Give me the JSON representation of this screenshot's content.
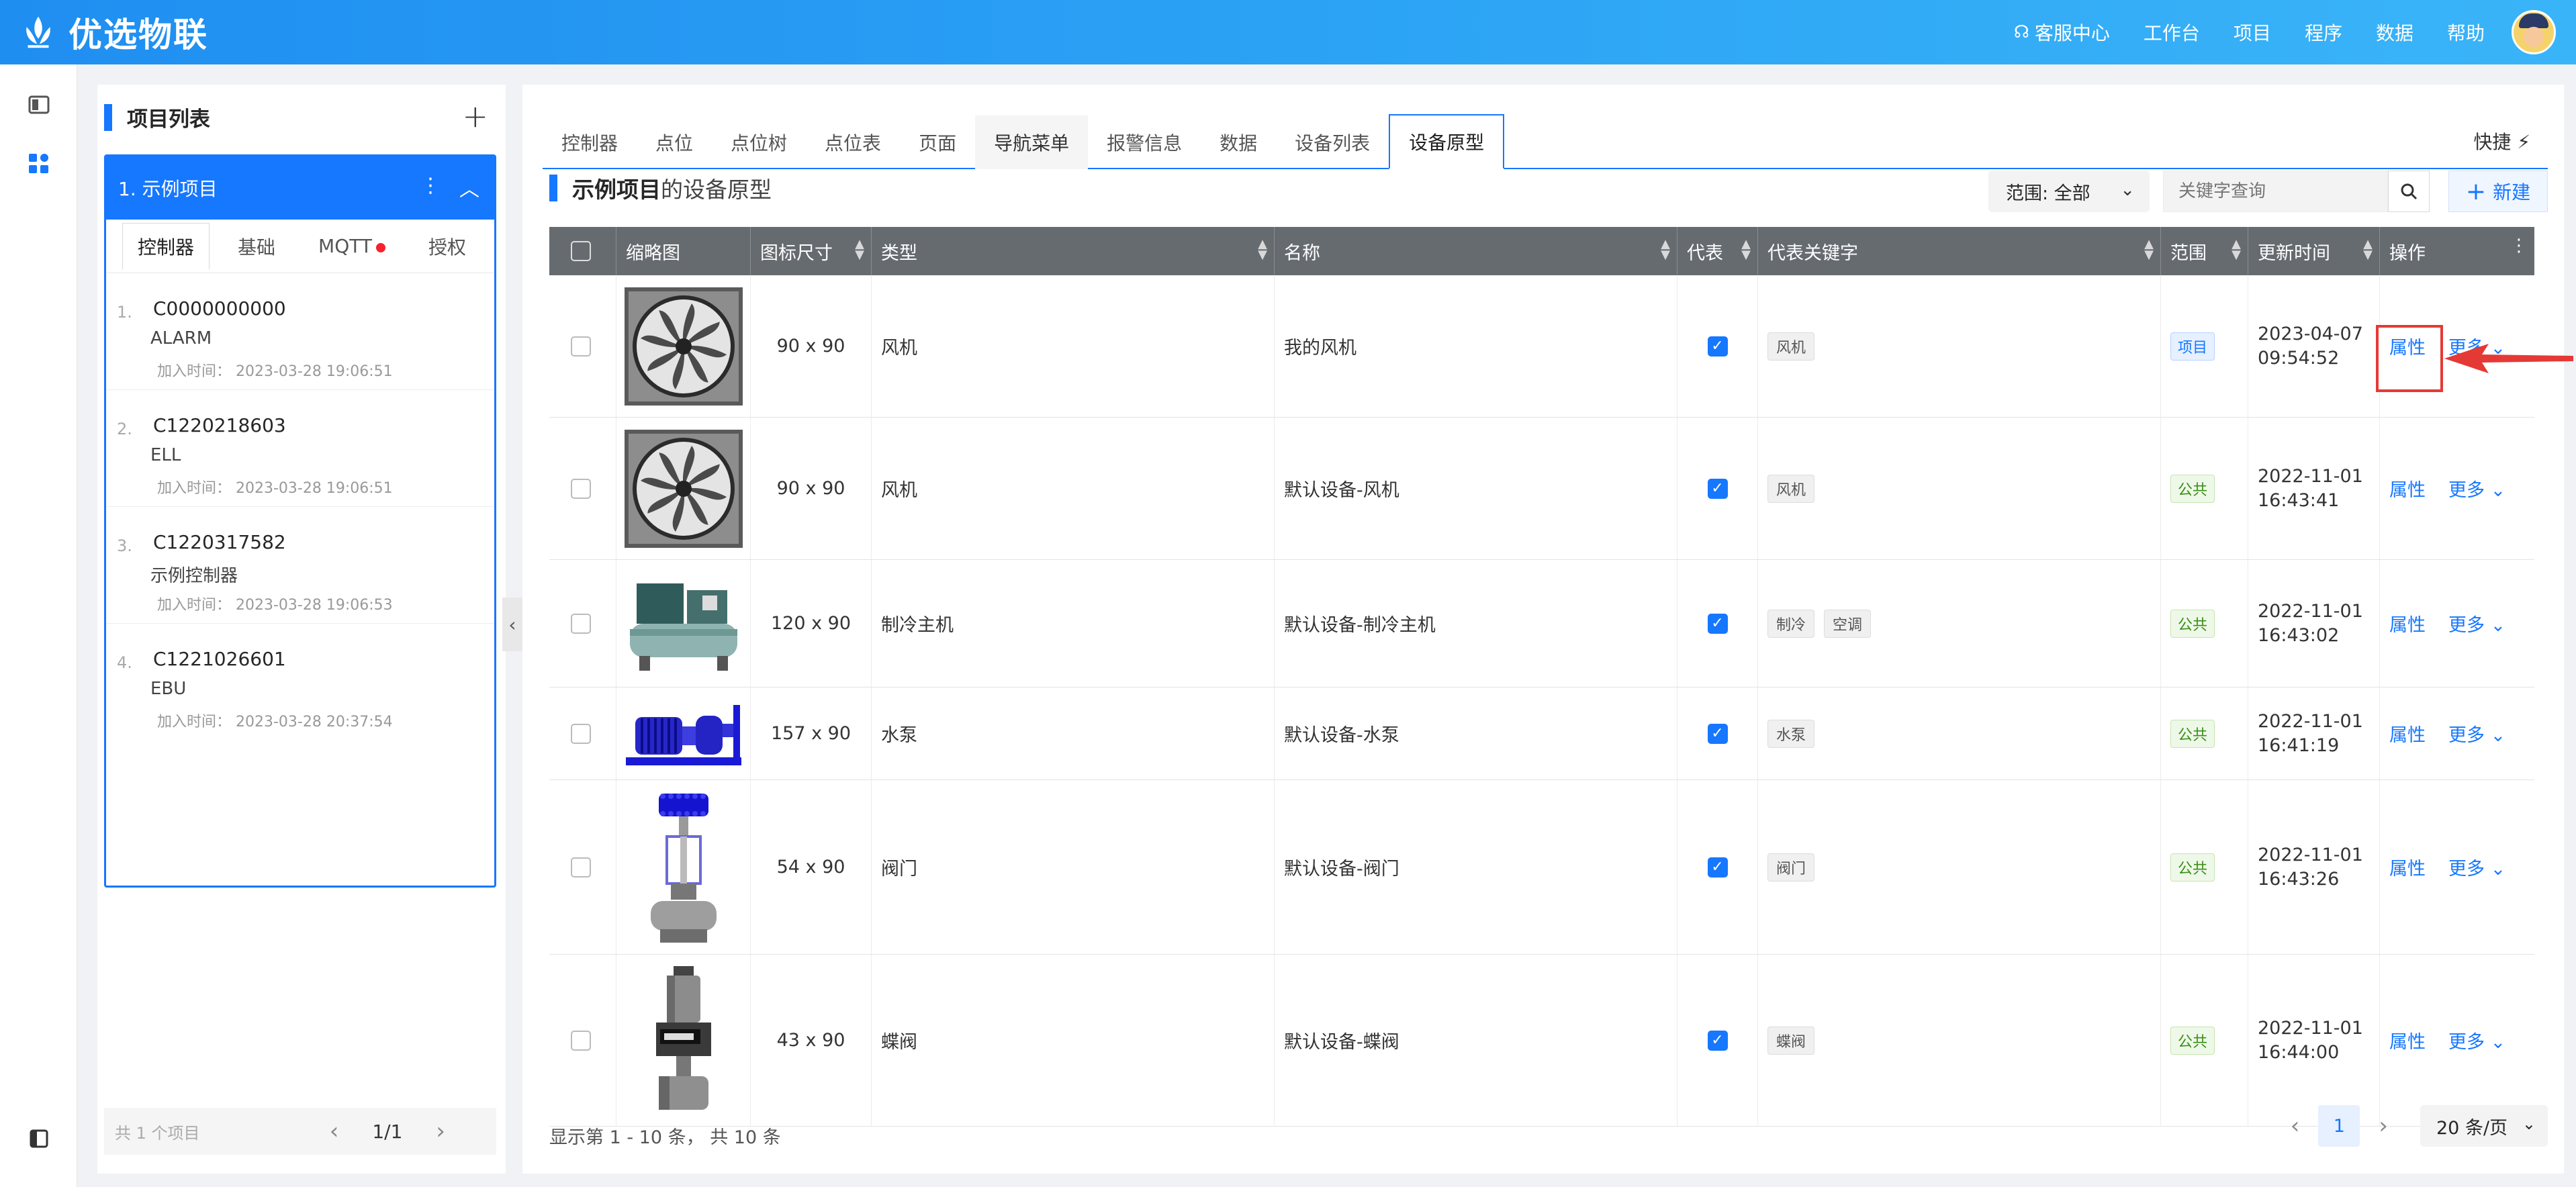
{
  "app": {
    "title": "优选物联"
  },
  "topnav": {
    "service": "客服中心",
    "workbench": "工作台",
    "project": "项目",
    "program": "程序",
    "data": "数据",
    "help": "帮助"
  },
  "left": {
    "title": "项目列表",
    "project_name": "1. 示例项目",
    "tabs": [
      "控制器",
      "基础",
      "MQTT",
      "授权"
    ],
    "controllers": [
      {
        "idx": "1.",
        "code": "C0000000000",
        "name": "ALARM",
        "time": "加入时间： 2023-03-28 19:06:51"
      },
      {
        "idx": "2.",
        "code": "C1220218603",
        "name": "ELL",
        "time": "加入时间： 2023-03-28 19:06:51"
      },
      {
        "idx": "3.",
        "code": "C1220317582",
        "name": "示例控制器",
        "time": "加入时间： 2023-03-28 19:06:53"
      },
      {
        "idx": "4.",
        "code": "C1221026601",
        "name": "EBU",
        "time": "加入时间： 2023-03-28 20:37:54"
      }
    ],
    "footer_count": "共 1 个项目",
    "page": "1/1"
  },
  "tabs": [
    "控制器",
    "点位",
    "点位树",
    "点位表",
    "页面",
    "导航菜单",
    "报警信息",
    "数据",
    "设备列表",
    "设备原型"
  ],
  "quick": "快捷",
  "section": {
    "project": "示例项目",
    "suffix": "的设备原型"
  },
  "toolbar": {
    "scope": "范围: 全部",
    "search_placeholder": "关键字查询",
    "new": "新建"
  },
  "table": {
    "headers": [
      "缩略图",
      "图标尺寸",
      "类型",
      "名称",
      "代表",
      "代表关键字",
      "范围",
      "更新时间",
      "操作"
    ],
    "action_attr": "属性",
    "action_more": "更多",
    "rows": [
      {
        "thumb": "fan",
        "size": "90 x 90",
        "type": "风机",
        "name": "我的风机",
        "keywords": [
          "风机"
        ],
        "scope": "项目",
        "scope_kind": "proj",
        "date": "2023-04-07",
        "time": "09:54:52"
      },
      {
        "thumb": "fan",
        "size": "90 x 90",
        "type": "风机",
        "name": "默认设备-风机",
        "keywords": [
          "风机"
        ],
        "scope": "公共",
        "scope_kind": "pub",
        "date": "2022-11-01",
        "time": "16:43:41"
      },
      {
        "thumb": "chiller",
        "size": "120 x 90",
        "type": "制冷主机",
        "name": "默认设备-制冷主机",
        "keywords": [
          "制冷",
          "空调"
        ],
        "scope": "公共",
        "scope_kind": "pub",
        "date": "2022-11-01",
        "time": "16:43:02"
      },
      {
        "thumb": "pump",
        "size": "157 x 90",
        "type": "水泵",
        "name": "默认设备-水泵",
        "keywords": [
          "水泵"
        ],
        "scope": "公共",
        "scope_kind": "pub",
        "date": "2022-11-01",
        "time": "16:41:19"
      },
      {
        "thumb": "valve",
        "size": "54 x 90",
        "type": "阀门",
        "name": "默认设备-阀门",
        "keywords": [
          "阀门"
        ],
        "scope": "公共",
        "scope_kind": "pub",
        "date": "2022-11-01",
        "time": "16:43:26"
      },
      {
        "thumb": "butterfly",
        "size": "43 x 90",
        "type": "蝶阀",
        "name": "默认设备-蝶阀",
        "keywords": [
          "蝶阀"
        ],
        "scope": "公共",
        "scope_kind": "pub",
        "date": "2022-11-01",
        "time": "16:44:00"
      }
    ]
  },
  "footer": {
    "summary": "显示第 1 - 10 条， 共 10 条",
    "page": "1",
    "page_size": "20 条/页"
  },
  "colors": {
    "primary": "#1677ff",
    "header_bg": "#666b70",
    "annotation": "#e53935"
  }
}
